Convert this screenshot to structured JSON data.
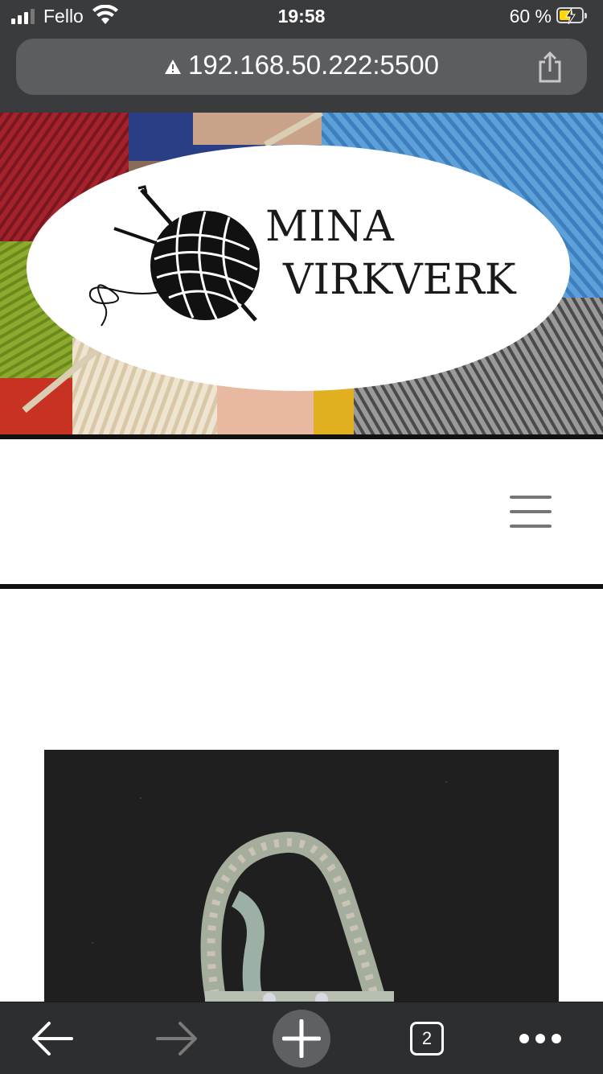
{
  "status_bar": {
    "carrier": "Fello",
    "time": "19:58",
    "battery_percent": "60 %",
    "signal_icon": "cellular-signal-icon",
    "wifi_icon": "wifi-icon",
    "battery_icon": "battery-charging-icon",
    "battery_level": 0.6
  },
  "browser": {
    "url": "192.168.50.222:5500",
    "security_icon": "warning-triangle-icon",
    "share_icon": "share-icon"
  },
  "header": {
    "logo_line1": "MINA",
    "logo_line2": "VIRKVERK",
    "logo_icon": "yarn-ball-crochet-hook-icon"
  },
  "nav": {
    "menu_icon": "hamburger-menu-icon"
  },
  "toolbar": {
    "back_icon": "arrow-left-icon",
    "forward_icon": "arrow-right-icon",
    "new_tab_icon": "plus-icon",
    "tabs_count": "2",
    "more_icon": "more-dots-icon"
  },
  "colors": {
    "chrome_bg": "#3a3b3d",
    "urlbar_bg": "#5b5d61",
    "toolbar_bg": "#2d2e30",
    "battery_fill": "#ffd60a",
    "rule": "#111111"
  }
}
